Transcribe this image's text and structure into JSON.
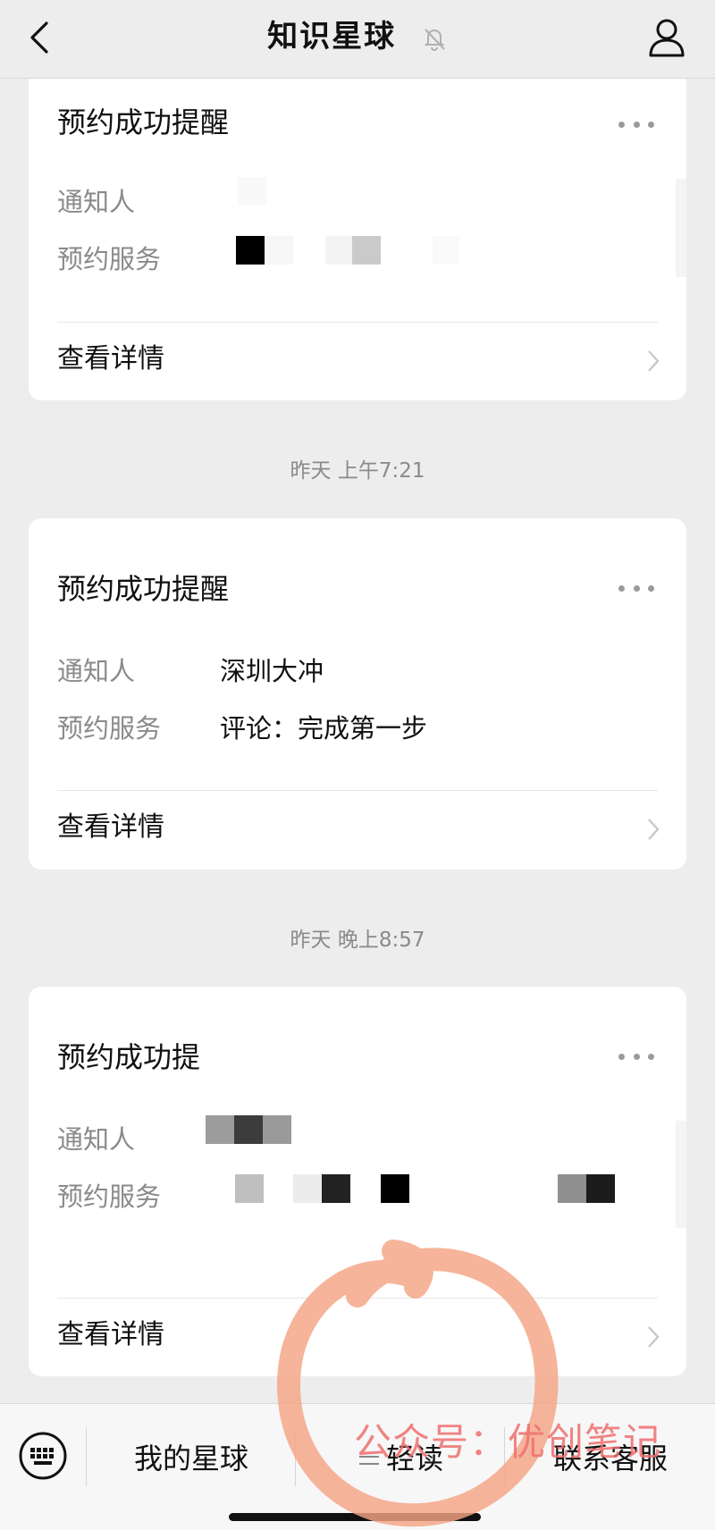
{
  "header": {
    "title": "知识星球"
  },
  "cards": [
    {
      "title": "预约成功提醒",
      "label_notify": "通知人",
      "label_service": "预约服务",
      "value_notify": "",
      "value_service": "",
      "detail": "查看详情"
    },
    {
      "title": "预约成功提醒",
      "label_notify": "通知人",
      "label_service": "预约服务",
      "value_notify": "深圳大冲",
      "value_service": "评论：完成第一步",
      "detail": "查看详情"
    },
    {
      "title": "预约成功提",
      "label_notify": "通知人",
      "label_service": "预约服务",
      "value_notify": "",
      "value_service": "",
      "detail": "查看详情"
    }
  ],
  "timestamps": [
    "昨天 上午7:21",
    "昨天 晚上8:57"
  ],
  "bottom_bar": {
    "menu1": "我的星球",
    "menu2": "轻读",
    "menu3": "联系客服"
  },
  "watermark": "公众号：优创笔记",
  "colors": {
    "background": "#ededed",
    "card": "#ffffff",
    "muted_text": "#8a8a8a",
    "annotation": "#f08060"
  }
}
